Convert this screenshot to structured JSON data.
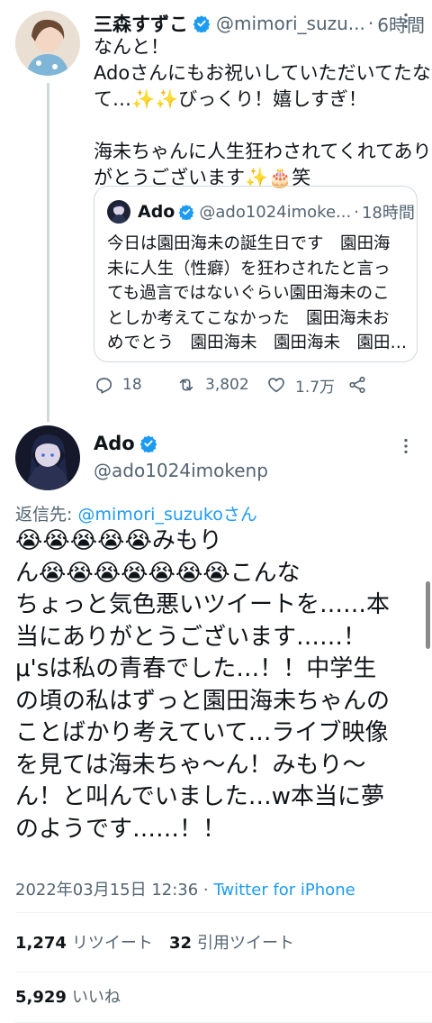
{
  "parent_tweet": {
    "name": "三森すずこ",
    "handle": "@mimori_suzu...",
    "time": "6時間",
    "text_lines": [
      "なんと！",
      "Adoさんにもお祝いしていただいてたなん",
      "て…✨✨びっくり！嬉しすぎ！",
      "",
      "海未ちゃんに人生狂わされてくれてあり",
      "がとうございます✨🎂笑"
    ],
    "quote": {
      "name": "Ado",
      "handle": "@ado1024imoke...",
      "time": "18時間",
      "text_lines": [
        "今日は園田海未の誕生日です　園田海",
        "未に人生（性癖）を狂わされたと言っ",
        "ても過言ではないぐらい園田海未のこ",
        "としか考えてこなかった　園田海未お",
        "めでとう　園田海未　園田海未　園田…"
      ]
    },
    "actions": {
      "replies": "18",
      "retweets": "3,802",
      "likes": "1.7万"
    }
  },
  "main_tweet": {
    "name": "Ado",
    "handle": "@ado1024imokenp",
    "reply_prefix": "返信先: ",
    "reply_user": "@mimori_suzukoさん",
    "text_lines": [
      "😭😭😭😭😭みもり",
      "ん😭😭😭😭😭😭😭こんな",
      "ちょっと気色悪いツイートを……本",
      "当にありがとうございます……！",
      "μ'sは私の青春でした…！！中学生",
      "の頃の私はずっと園田海未ちゃんの",
      "ことばかり考えていて…ライブ映像",
      "を見ては海未ちゃ〜ん！みもり〜",
      "ん！と叫んでいました…w本当に夢",
      "のようです……！！"
    ],
    "timestamp": "2022年03月15日 12:36 · ",
    "source": "Twitter for iPhone",
    "stats": {
      "retweets_count": "1,274",
      "retweets_label": "リツイート",
      "quotes_count": "32",
      "quotes_label": "引用ツイート",
      "likes_count": "5,929",
      "likes_label": "いいね"
    }
  },
  "colors": {
    "accent": "#1d9bf0",
    "secondary_text": "#536471",
    "border": "#cfd9de"
  }
}
